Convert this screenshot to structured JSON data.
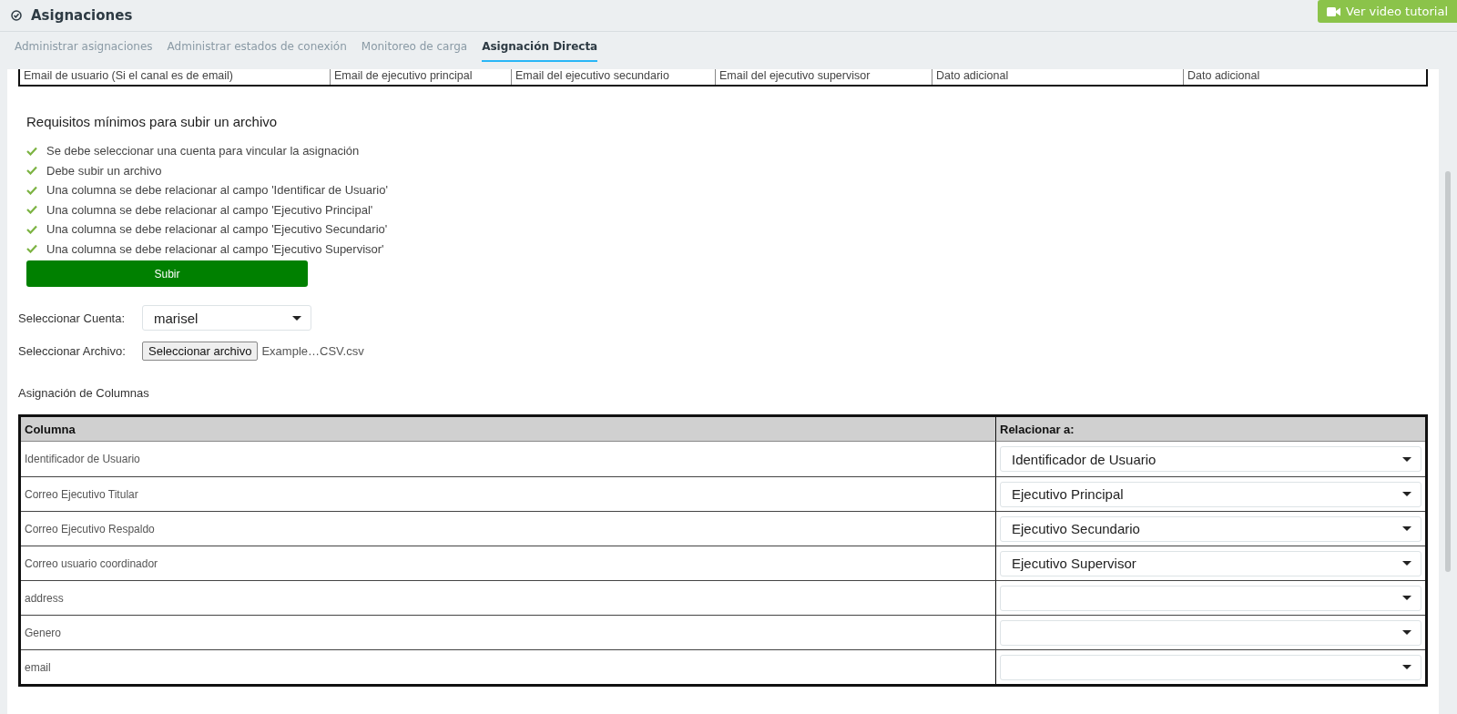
{
  "header": {
    "title": "Asignaciones",
    "tutorial_button": "Ver video tutorial"
  },
  "tabs": [
    {
      "label": "Administrar asignaciones",
      "selected": false
    },
    {
      "label": "Administrar estados de conexión",
      "selected": false
    },
    {
      "label": "Monitoreo de carga",
      "selected": false
    },
    {
      "label": "Asignación Directa",
      "selected": true
    }
  ],
  "format_table": {
    "columns": [
      "Email de usuario (Si el canal es de email)",
      "Email de ejecutivo principal",
      "Email del ejecutivo secundario",
      "Email del ejecutivo supervisor",
      "Dato adicional",
      "Dato adicional"
    ]
  },
  "requirements": {
    "title": "Requisitos mínimos para subir un archivo",
    "items": [
      {
        "text": "Se debe seleccionar una cuenta para vincular la asignación",
        "checked": true
      },
      {
        "text": "Debe subir un archivo",
        "checked": true
      },
      {
        "text": "Una columna se debe relacionar al campo 'Identificar de Usuario'",
        "checked": true
      },
      {
        "text": "Una columna se debe relacionar al campo 'Ejecutivo Principal'",
        "checked": true
      },
      {
        "text": "Una columna se debe relacionar al campo 'Ejecutivo Secundario'",
        "checked": true
      },
      {
        "text": "Una columna se debe relacionar al campo 'Ejecutivo Supervisor'",
        "checked": true
      }
    ],
    "upload_button": "Subir"
  },
  "account": {
    "label": "Seleccionar Cuenta:",
    "value": "marisel"
  },
  "file": {
    "label": "Seleccionar Archivo:",
    "button": "Seleccionar archivo",
    "filename": "Example…CSV.csv"
  },
  "mapping": {
    "title": "Asignación de Columnas",
    "columns": [
      "Columna",
      "Relacionar a:"
    ],
    "rows": [
      {
        "column": "Identificador de Usuario",
        "relate_to": "Identificador de Usuario"
      },
      {
        "column": "Correo Ejecutivo Titular",
        "relate_to": "Ejecutivo Principal"
      },
      {
        "column": "Correo Ejecutivo Respaldo",
        "relate_to": "Ejecutivo Secundario"
      },
      {
        "column": "Correo usuario coordinador",
        "relate_to": "Ejecutivo Supervisor"
      },
      {
        "column": "address"
      },
      {
        "column": "Genero"
      },
      {
        "column": "email"
      }
    ]
  }
}
